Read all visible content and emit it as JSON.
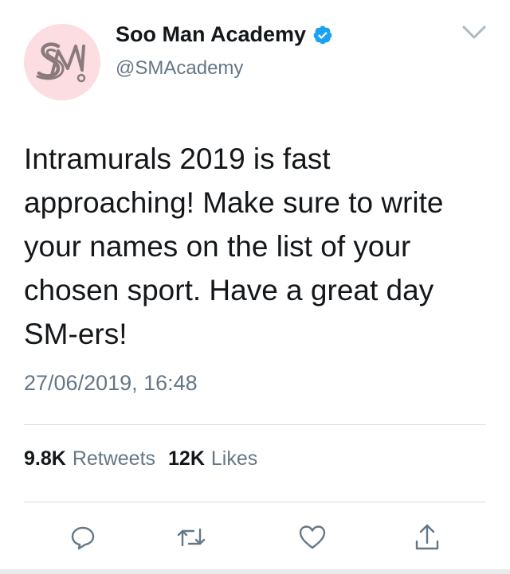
{
  "user": {
    "display_name": "Soo Man Academy",
    "handle": "@SMAcademy",
    "verified": true,
    "avatar_icon": "sm-logo-icon",
    "avatar_bg_color": "#fbdde2",
    "avatar_logo_color": "#8a7a7e"
  },
  "tweet": {
    "text": "Intramurals 2019 is fast approaching! Make sure to write your names on the list of your chosen sport. Have a great day SM-ers!",
    "timestamp": "27/06/2019, 16:48"
  },
  "stats": {
    "retweets_count": "9.8K",
    "retweets_label": "Retweets",
    "likes_count": "12K",
    "likes_label": "Likes"
  },
  "actions": [
    {
      "name": "reply",
      "icon": "reply-icon"
    },
    {
      "name": "retweet",
      "icon": "retweet-icon"
    },
    {
      "name": "like",
      "icon": "heart-icon"
    },
    {
      "name": "share",
      "icon": "share-icon"
    }
  ],
  "colors": {
    "text_primary": "#14171a",
    "text_secondary": "#657786",
    "verified_blue": "#1da1f2",
    "divider": "#d7dde2"
  }
}
